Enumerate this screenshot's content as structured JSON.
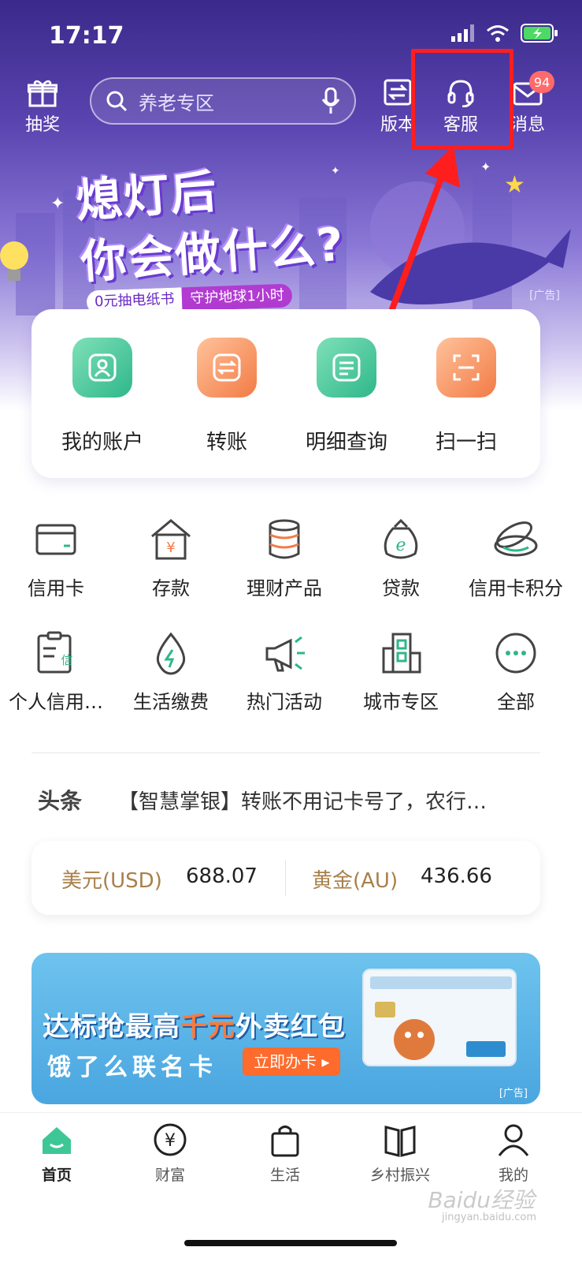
{
  "status": {
    "time": "17:17"
  },
  "top_bar": {
    "lottery_label": "抽奖",
    "search_placeholder": "养老专区",
    "version_label": "版本",
    "service_label": "客服",
    "message_label": "消息",
    "message_badge": "94"
  },
  "banner": {
    "line1": "熄灯后",
    "line2": "你会做什么?",
    "sub_a": "0元抽电纸书",
    "sub_b": "守护地球1小时",
    "ad_tag": "[广告]"
  },
  "quick_actions": [
    {
      "label": "我的账户",
      "icon": "account-icon",
      "color": "#2fb78b"
    },
    {
      "label": "转账",
      "icon": "transfer-icon",
      "color": "#f27b46"
    },
    {
      "label": "明细查询",
      "icon": "detail-query-icon",
      "color": "#2fb78b"
    },
    {
      "label": "扫一扫",
      "icon": "scan-icon",
      "color": "#f27b46"
    }
  ],
  "services_row1": [
    {
      "label": "信用卡",
      "icon": "credit-card-icon"
    },
    {
      "label": "存款",
      "icon": "deposit-icon"
    },
    {
      "label": "理财产品",
      "icon": "wealth-product-icon"
    },
    {
      "label": "贷款",
      "icon": "loan-icon"
    },
    {
      "label": "信用卡积分",
      "icon": "credit-points-icon"
    }
  ],
  "services_row2": [
    {
      "label": "个人信用…",
      "icon": "personal-credit-icon"
    },
    {
      "label": "生活缴费",
      "icon": "utility-payment-icon"
    },
    {
      "label": "热门活动",
      "icon": "hot-activity-icon"
    },
    {
      "label": "城市专区",
      "icon": "city-zone-icon"
    },
    {
      "label": "全部",
      "icon": "more-icon"
    }
  ],
  "news": {
    "tag": "头条",
    "text": "【智慧掌银】转账不用记卡号了，农行…"
  },
  "rates": {
    "usd_name": "美元(USD)",
    "usd_value": "688.07",
    "gold_name": "黄金(AU)",
    "gold_value": "436.66"
  },
  "promo": {
    "title_a": "达标抢最高",
    "title_hl": "千元",
    "title_b": "外卖红包",
    "subtitle": "饿了么联名卡",
    "button": "立即办卡 ▸",
    "ad_tag": "[广告]"
  },
  "tabs": [
    {
      "label": "首页",
      "icon": "home-icon",
      "active": true
    },
    {
      "label": "财富",
      "icon": "wealth-icon",
      "active": false
    },
    {
      "label": "生活",
      "icon": "life-bag-icon",
      "active": false
    },
    {
      "label": "乡村振兴",
      "icon": "rural-book-icon",
      "active": false
    },
    {
      "label": "我的",
      "icon": "profile-icon",
      "active": false
    }
  ],
  "watermark": {
    "text": "Baidu经验",
    "sub": "jingyan.baidu.com"
  },
  "colors": {
    "accent_green": "#2fb78b",
    "accent_orange": "#f27b46",
    "highlight_red": "#ff1e1e",
    "gold_text": "#a8804a"
  }
}
